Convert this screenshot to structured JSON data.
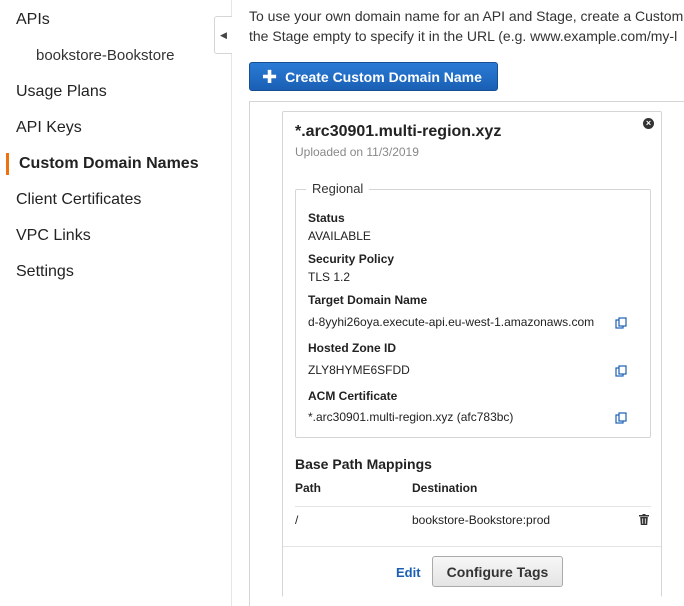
{
  "sidebar": {
    "items": [
      {
        "label": "APIs"
      },
      {
        "label": "bookstore-Bookstore"
      },
      {
        "label": "Usage Plans"
      },
      {
        "label": "API Keys"
      },
      {
        "label": "Custom Domain Names"
      },
      {
        "label": "Client Certificates"
      },
      {
        "label": "VPC Links"
      },
      {
        "label": "Settings"
      }
    ],
    "active_item": "Custom Domain Names",
    "collapse_icon": "chevron-left-icon"
  },
  "main": {
    "intro_line1": "To use your own domain name for an API and Stage, create a Custom",
    "intro_line2": "the Stage empty to specify it in the URL (e.g. www.example.com/my-l",
    "create_button": "Create Custom Domain Name",
    "create_icon": "plus-icon"
  },
  "card": {
    "title": "*.arc30901.multi-region.xyz",
    "uploaded": "Uploaded on 11/3/2019",
    "section_label": "Regional",
    "fields": [
      {
        "label": "Status",
        "value": "AVAILABLE"
      },
      {
        "label": "Security Policy",
        "value": "TLS 1.2"
      },
      {
        "label": "Target Domain Name",
        "value": "d-8yyhi26oya.execute-api.eu-west-1.amazonaws.com"
      },
      {
        "label": "Hosted Zone ID",
        "value": "ZLY8HYME6SFDD"
      },
      {
        "label": "ACM Certificate",
        "value": "*.arc30901.multi-region.xyz (afc783bc)"
      }
    ],
    "base_path": {
      "title": "Base Path Mappings",
      "columns": [
        "Path",
        "Destination"
      ],
      "rows": [
        {
          "path": "/",
          "destination": "bookstore-Bookstore:prod"
        }
      ]
    },
    "edit_label": "Edit",
    "tags_button": "Configure Tags"
  },
  "colors": {
    "active_accent": "#ec7211",
    "primary_button": "#1a5fb4",
    "link": "#1a5fb4",
    "copy_icon": "#1a5fb4"
  }
}
